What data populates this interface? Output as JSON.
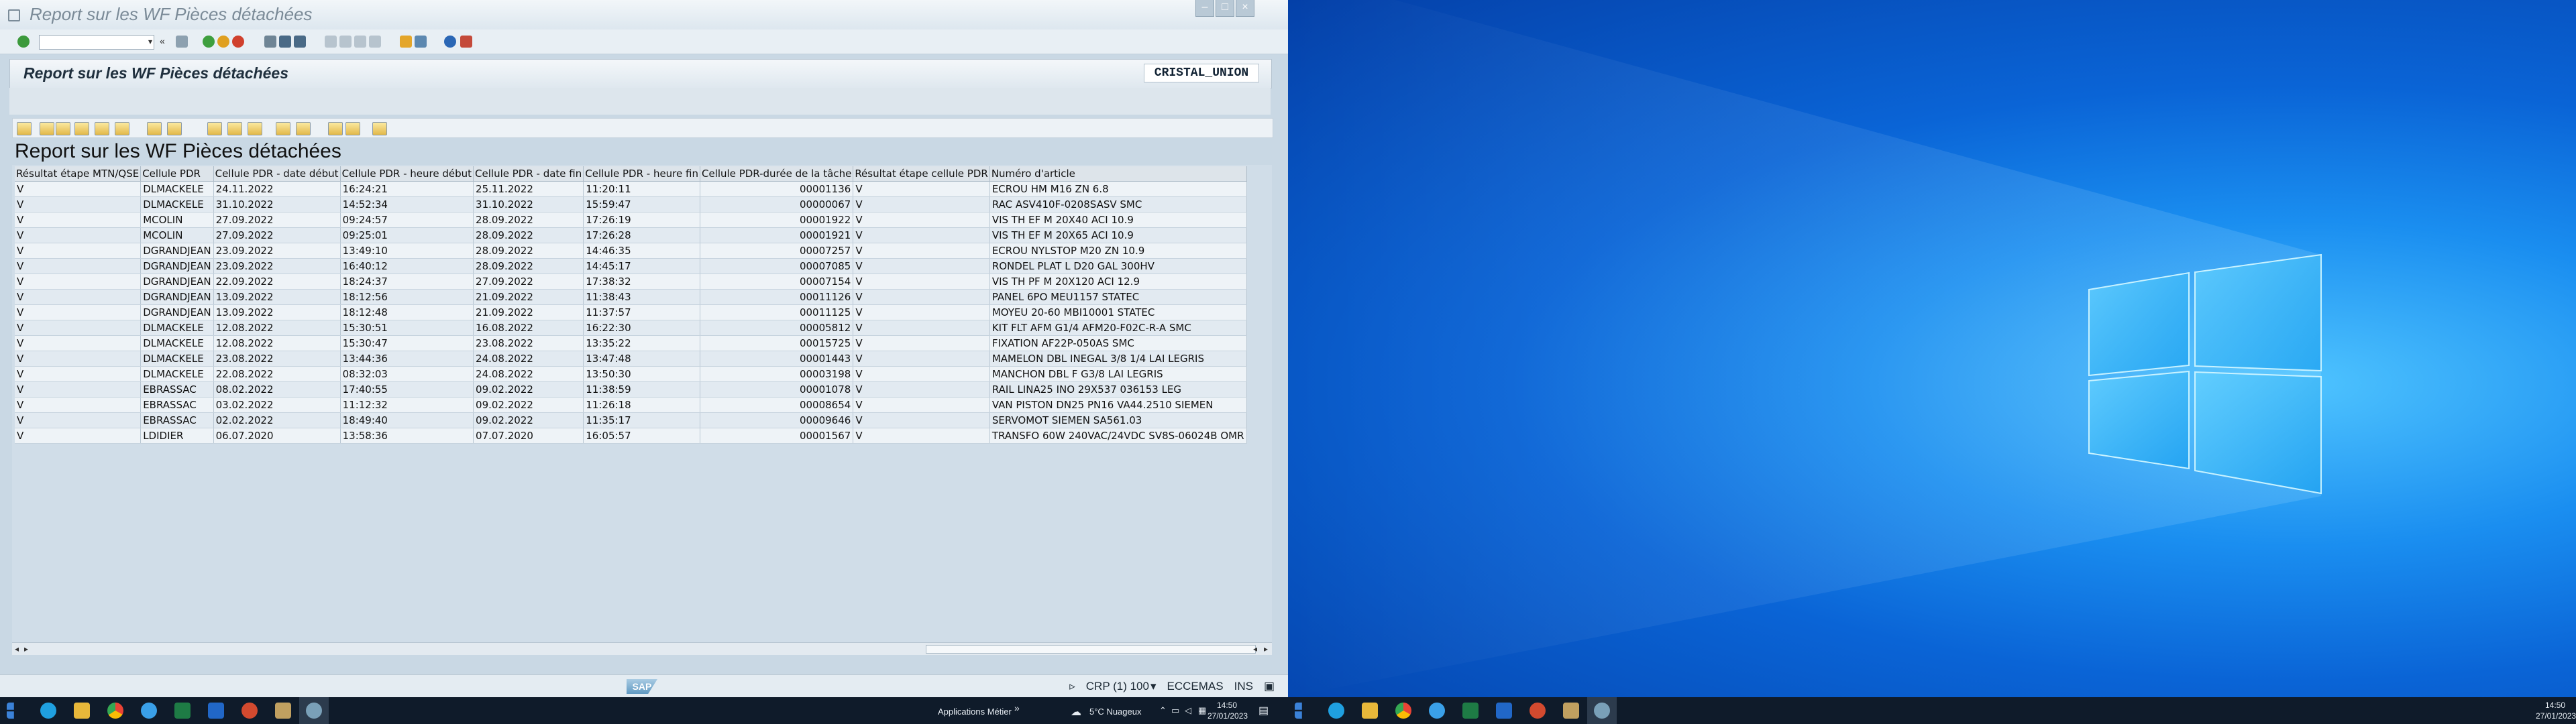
{
  "window": {
    "title": "Report sur les WF Pièces détachées",
    "controls": [
      "–",
      "□",
      "×"
    ]
  },
  "header": {
    "title": "Report sur les WF Pièces détachées",
    "client": "CRISTAL_UNION"
  },
  "report": {
    "title": "Report sur les WF Pièces détachées"
  },
  "table": {
    "columns": [
      "Résultat étape MTN/QSE",
      "Cellule PDR",
      "Cellule PDR - date début",
      "Cellule PDR - heure début",
      "Cellule PDR - date fin",
      "Cellule PDR - heure fin",
      "Cellule PDR-durée de la tâche",
      "Résultat étape cellule PDR",
      "Numéro d'article"
    ],
    "rows": [
      [
        "V",
        "DLMACKELE",
        "24.11.2022",
        "16:24:21",
        "25.11.2022",
        "11:20:11",
        "00001136",
        "V",
        "ECROU HM M16 ZN 6.8"
      ],
      [
        "V",
        "DLMACKELE",
        "31.10.2022",
        "14:52:34",
        "31.10.2022",
        "15:59:47",
        "00000067",
        "V",
        "RAC ASV410F-0208SASV SMC"
      ],
      [
        "V",
        "MCOLIN",
        "27.09.2022",
        "09:24:57",
        "28.09.2022",
        "17:26:19",
        "00001922",
        "V",
        "VIS TH EF M 20X40 ACI 10.9"
      ],
      [
        "V",
        "MCOLIN",
        "27.09.2022",
        "09:25:01",
        "28.09.2022",
        "17:26:28",
        "00001921",
        "V",
        "VIS TH EF M 20X65 ACI 10.9"
      ],
      [
        "V",
        "DGRANDJEAN",
        "23.09.2022",
        "13:49:10",
        "28.09.2022",
        "14:46:35",
        "00007257",
        "V",
        "ECROU NYLSTOP M20 ZN 10.9"
      ],
      [
        "V",
        "DGRANDJEAN",
        "23.09.2022",
        "16:40:12",
        "28.09.2022",
        "14:45:17",
        "00007085",
        "V",
        "RONDEL PLAT L D20 GAL 300HV"
      ],
      [
        "V",
        "DGRANDJEAN",
        "22.09.2022",
        "18:24:37",
        "27.09.2022",
        "17:38:32",
        "00007154",
        "V",
        "VIS TH PF M 20X120 ACI 12.9"
      ],
      [
        "V",
        "DGRANDJEAN",
        "13.09.2022",
        "18:12:56",
        "21.09.2022",
        "11:38:43",
        "00011126",
        "V",
        "PANEL 6PO MEU1157 STATEC"
      ],
      [
        "V",
        "DGRANDJEAN",
        "13.09.2022",
        "18:12:48",
        "21.09.2022",
        "11:37:57",
        "00011125",
        "V",
        "MOYEU 20-60 MBI10001 STATEC"
      ],
      [
        "V",
        "DLMACKELE",
        "12.08.2022",
        "15:30:51",
        "16.08.2022",
        "16:22:30",
        "00005812",
        "V",
        "KIT FLT AFM G1/4 AFM20-F02C-R-A SMC"
      ],
      [
        "V",
        "DLMACKELE",
        "12.08.2022",
        "15:30:47",
        "23.08.2022",
        "13:35:22",
        "00015725",
        "V",
        "FIXATION AF22P-050AS SMC"
      ],
      [
        "V",
        "DLMACKELE",
        "23.08.2022",
        "13:44:36",
        "24.08.2022",
        "13:47:48",
        "00001443",
        "V",
        "MAMELON DBL INEGAL 3/8 1/4 LAI LEGRIS"
      ],
      [
        "V",
        "DLMACKELE",
        "22.08.2022",
        "08:32:03",
        "24.08.2022",
        "13:50:30",
        "00003198",
        "V",
        "MANCHON DBL F G3/8 LAI LEGRIS"
      ],
      [
        "V",
        "EBRASSAC",
        "08.02.2022",
        "17:40:55",
        "09.02.2022",
        "11:38:59",
        "00001078",
        "V",
        "RAIL LINA25 INO 29X537 036153 LEG"
      ],
      [
        "V",
        "EBRASSAC",
        "03.02.2022",
        "11:12:32",
        "09.02.2022",
        "11:26:18",
        "00008654",
        "V",
        "VAN PISTON DN25 PN16 VA44.2510 SIEMEN"
      ],
      [
        "V",
        "EBRASSAC",
        "02.02.2022",
        "18:49:40",
        "09.02.2022",
        "11:35:17",
        "00009646",
        "V",
        "SERVOMOT SIEMEN SA561.03"
      ],
      [
        "V",
        "LDIDIER",
        "06.07.2020",
        "13:58:36",
        "07.07.2020",
        "16:05:57",
        "00001567",
        "V",
        "TRANSFO 60W 240VAC/24VDC SV8S-06024B OMR"
      ]
    ]
  },
  "statusbar": {
    "logo": "SAP",
    "system": "CRP (1) 100",
    "user": "ECCEMAS",
    "mode": "INS"
  },
  "taskbar_left": {
    "label": "Applications Métier",
    "weather": "5°C  Nuageux",
    "time": "14:50",
    "date": "27/01/2023"
  },
  "taskbar_right": {
    "time": "14:50",
    "date": "27/01/2023"
  },
  "colors": {
    "sap_bg": "#c9d8e4",
    "desktop_blue": "#0a64d6",
    "taskbar": "#0f1b2a"
  }
}
